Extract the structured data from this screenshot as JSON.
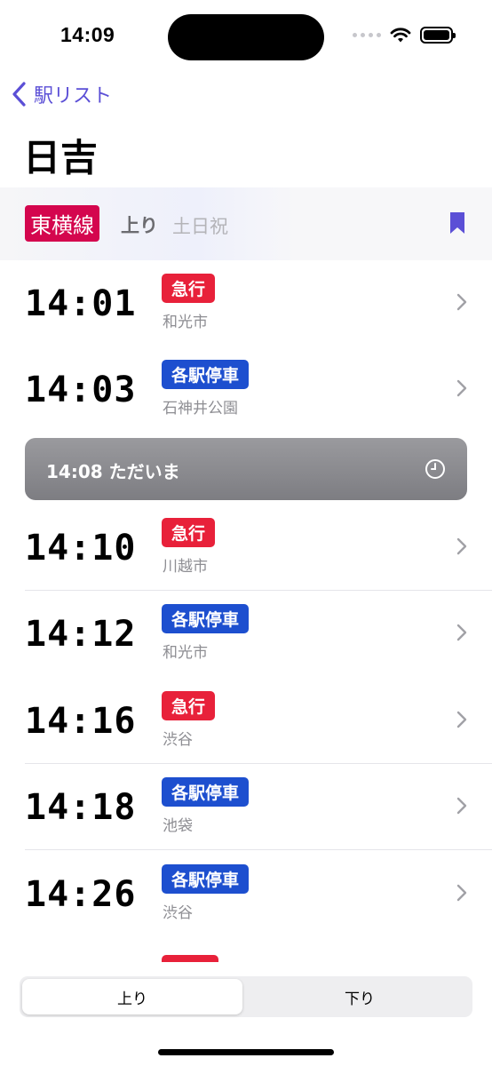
{
  "status_bar": {
    "time": "14:09"
  },
  "nav": {
    "back_label": "駅リスト",
    "title": "日吉"
  },
  "header": {
    "line_name": "東横線",
    "line_color": "#d4064e",
    "direction": "上り",
    "day_type": "土日祝",
    "bookmark_icon": "bookmark-icon"
  },
  "colors": {
    "express": "#e8213a",
    "local": "#1d4fcf",
    "accent": "#5b4fd6"
  },
  "trains": [
    {
      "time": "14:01",
      "type": "急行",
      "kind": "express",
      "destination": "和光市"
    },
    {
      "time": "14:03",
      "type": "各駅停車",
      "kind": "local",
      "destination": "石神井公園"
    },
    {
      "time": "14:10",
      "type": "急行",
      "kind": "express",
      "destination": "川越市"
    },
    {
      "time": "14:12",
      "type": "各駅停車",
      "kind": "local",
      "destination": "和光市"
    },
    {
      "time": "14:16",
      "type": "急行",
      "kind": "express",
      "destination": "渋谷"
    },
    {
      "time": "14:18",
      "type": "各駅停車",
      "kind": "local",
      "destination": "池袋"
    },
    {
      "time": "14:26",
      "type": "各駅停車",
      "kind": "local",
      "destination": "渋谷"
    }
  ],
  "now_marker": {
    "text": "14:08 ただいま",
    "icon": "clock-icon"
  },
  "segments": {
    "selected": "上り",
    "other": "下り"
  }
}
